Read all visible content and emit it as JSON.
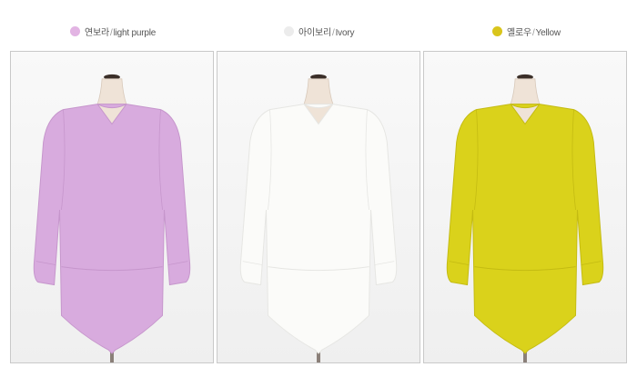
{
  "colors": [
    {
      "korean": "연보라",
      "english": "light purple",
      "dot_color": "#e2b4e3",
      "garment_color": "#d8abde",
      "shade_color": "#c696cc"
    },
    {
      "korean": "아이보리",
      "english": "Ivory",
      "dot_color": "#ececec",
      "garment_color": "#fbfbf9",
      "shade_color": "#e6e6e3"
    },
    {
      "korean": "옐로우",
      "english": "Yellow",
      "dot_color": "#d9c51c",
      "garment_color": "#dad21b",
      "shade_color": "#c4bb12"
    }
  ],
  "separator": "/"
}
